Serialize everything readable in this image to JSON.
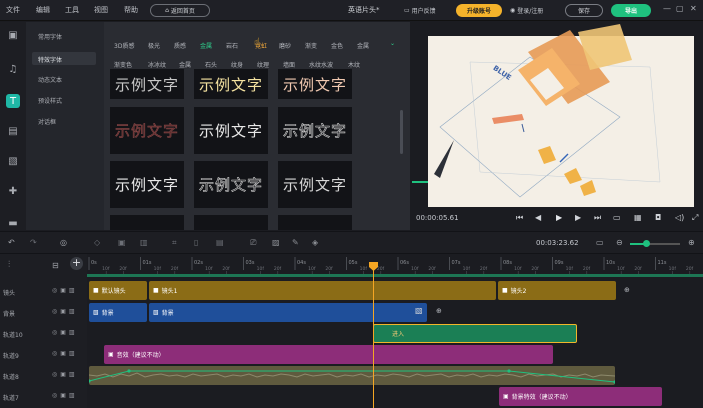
{
  "menu": {
    "items": [
      "文件",
      "编辑",
      "工具",
      "视图",
      "帮助"
    ],
    "back_home": "返回首页"
  },
  "title": "英语片头*",
  "toolbar": {
    "feedback": "用户反馈",
    "upgrade": "升级账号",
    "login": "登录/注册",
    "save": "保存",
    "export": "导出"
  },
  "categories": [
    "常用字体",
    "特效字体",
    "动态文本",
    "预设样式",
    "对话框"
  ],
  "active_category": "特效字体",
  "style_tabs_row1": [
    "3D质感",
    "极光",
    "质感",
    "金属",
    "岩石",
    "霓虹",
    "磨砂",
    "渐变",
    "金色",
    "金属"
  ],
  "style_tabs_row2": [
    "渐变色",
    "冰冰纹",
    "金属",
    "石头",
    "纹身",
    "纹理",
    "墙面",
    "水纹水波",
    "木纹"
  ],
  "sample_text": "示例文字",
  "preview": {
    "current_time": "00:00:05.61",
    "blue_label": "BLUE"
  },
  "timeline": {
    "total_time": "00:03:23.62",
    "ruler_labels": [
      "0s",
      "01s",
      "02s",
      "03s",
      "04s",
      "05s",
      "06s",
      "07s",
      "08s",
      "09s",
      "10s",
      "11s"
    ],
    "ruler_sub": [
      "10f",
      "20f"
    ],
    "tracks": [
      "镜头",
      "背景",
      "轨道10",
      "轨道9",
      "轨道8",
      "轨道7"
    ],
    "clips": {
      "default_shot": "默认镜头",
      "shot1": "镜头1",
      "shot2": "镜头2",
      "bg1": "背景",
      "bg2": "背景",
      "text_in": "进入",
      "sound": "音效（建议不动）",
      "bg_effect": "背景特效（建议不动）"
    }
  },
  "colors": {
    "accent_green": "#1fc17f",
    "upgrade_gold": "#f5b32b",
    "playhead": "#f5a623"
  }
}
